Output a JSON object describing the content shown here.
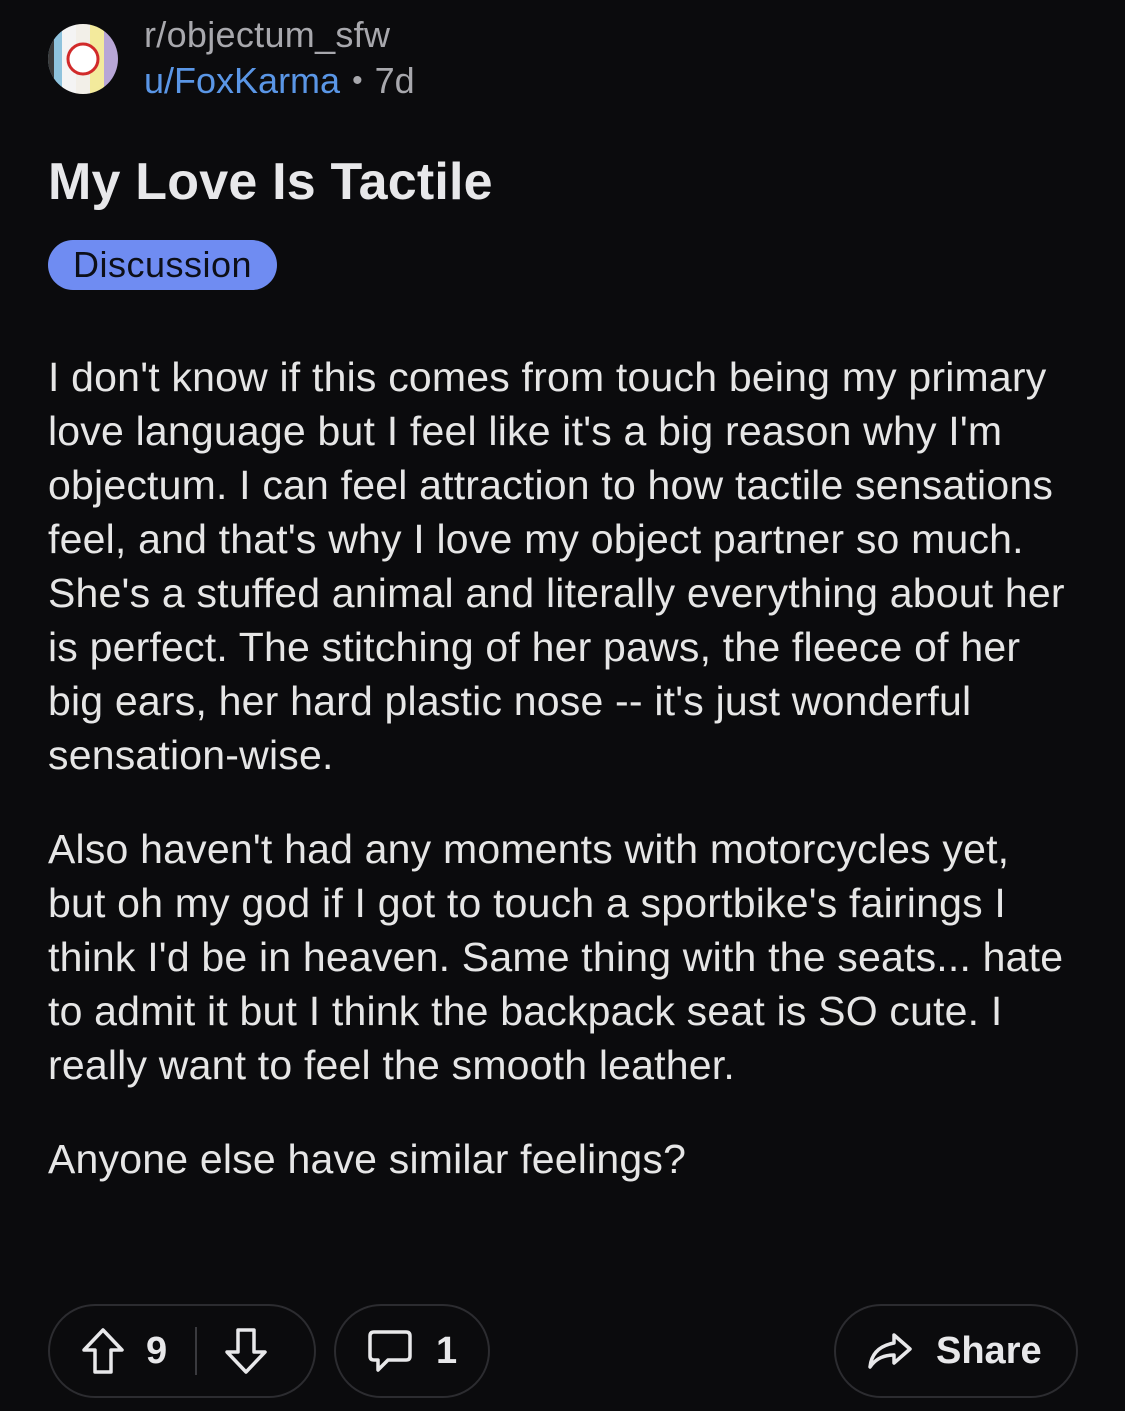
{
  "header": {
    "subreddit": "r/objectum_sfw",
    "username": "u/FoxKarma",
    "separator": "•",
    "age": "7d",
    "avatar_icon": "subreddit-flag-avatar"
  },
  "post": {
    "title": "My Love Is Tactile",
    "flair": "Discussion",
    "paragraphs": [
      "I don't know if this comes from touch being my primary love language but I feel like it's a big reason why I'm objectum. I can feel attraction to how tactile sensations feel, and that's why I love my object partner so much. She's a stuffed animal and literally everything about her is perfect. The stitching of her paws, the fleece of her big ears, her hard plastic nose -- it's just wonderful sensation-wise.",
      "Also haven't had any moments with motorcycles yet, but oh my god if I got to touch a sportbike's fairings I think I'd be in heaven. Same thing with the seats... hate to admit it but I think the backpack seat is SO cute. I really want to feel the smooth leather.",
      "Anyone else have similar feelings?"
    ]
  },
  "actions": {
    "upvote_icon": "upvote-arrow-icon",
    "vote_count": "9",
    "downvote_icon": "downvote-arrow-icon",
    "comment_icon": "comment-bubble-icon",
    "comment_count": "1",
    "share_icon": "share-arrow-icon",
    "share_label": "Share"
  },
  "colors": {
    "background": "#0b0b0d",
    "username": "#5a96e6",
    "flair_bg": "#6f8cf2",
    "text": "#e6e6e6",
    "muted": "#a8a8ad"
  }
}
